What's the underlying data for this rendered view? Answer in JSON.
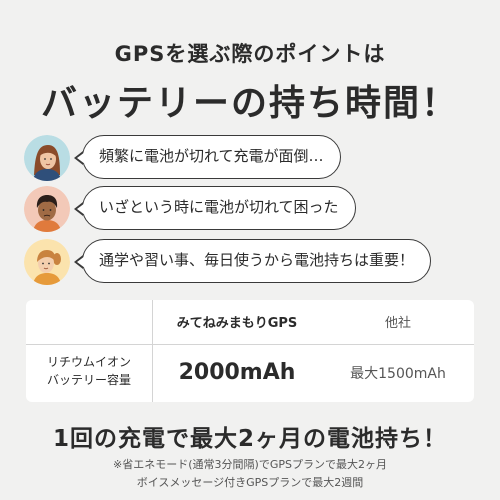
{
  "header": {
    "subtitle": "GPSを選ぶ際のポイントは",
    "title": "バッテリーの持ち時間！"
  },
  "comments": [
    {
      "text": "頻繁に電池が切れて充電が面倒…",
      "avatar": "woman-brown-hair-avatar"
    },
    {
      "text": "いざという時に電池が切れて困った",
      "avatar": "man-dark-hair-avatar"
    },
    {
      "text": "通学や習い事、毎日使うから電池持ちは重要！",
      "avatar": "girl-ponytail-avatar"
    }
  ],
  "comparison": {
    "col_mine": "みてねみまもりGPS",
    "col_other": "他社",
    "row_label_line1": "リチウムイオン",
    "row_label_line2": "バッテリー容量",
    "value_mine": "2000mAh",
    "value_other": "最大1500mAh"
  },
  "footer": {
    "headline": "1回の充電で最大2ヶ月の電池持ち！",
    "note_line1": "※省エネモード(通常3分間隔)でGPSプランで最大2ヶ月",
    "note_line2": "ボイスメッセージ付きGPSプランで最大2週間"
  },
  "colors": {
    "background": "#f1f1f0",
    "avatar_bg_1": "#b9dde4",
    "avatar_bg_2": "#f3c9b8",
    "avatar_bg_3": "#fbe3ad"
  }
}
